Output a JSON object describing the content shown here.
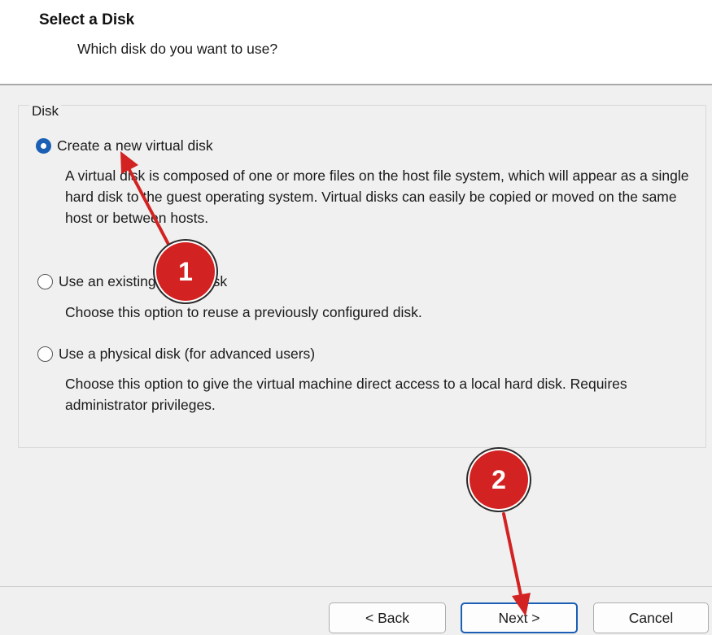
{
  "header": {
    "title": "Select a Disk",
    "subtitle": "Which disk do you want to use?"
  },
  "group": {
    "legend": "Disk"
  },
  "options": [
    {
      "label": "Create a new virtual disk",
      "checked": true,
      "description": "A virtual disk is composed of one or more files on the host file system, which will appear as a single hard disk to the guest operating system. Virtual disks can easily be copied or moved on the same host or between hosts."
    },
    {
      "label": "Use an existing virtual disk",
      "checked": false,
      "description": "Choose this option to reuse a previously configured disk."
    },
    {
      "label": "Use a physical disk (for advanced users)",
      "checked": false,
      "description": "Choose this option to give the virtual machine direct access to a local hard disk. Requires administrator privileges."
    }
  ],
  "footer": {
    "back_label": "< Back",
    "next_label": "Next >",
    "cancel_label": "Cancel"
  },
  "annotations": {
    "badge_1": "1",
    "badge_2": "2",
    "color": "#d32222"
  },
  "colors": {
    "accent": "#1a5fb4",
    "panel_bg": "#f0f0f0"
  }
}
